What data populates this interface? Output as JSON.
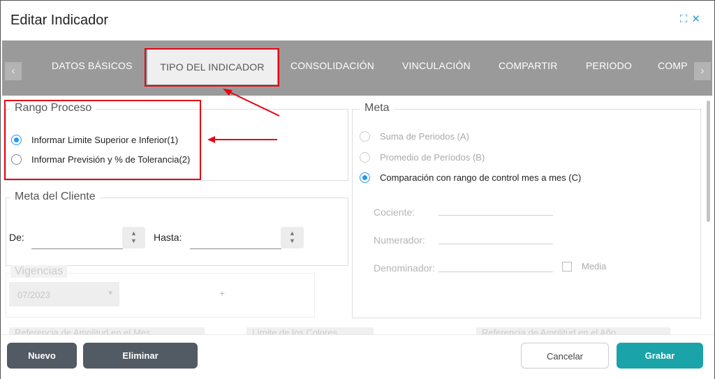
{
  "dialog": {
    "title": "Editar Indicador"
  },
  "tabs": [
    {
      "label": "DATOS BÁSICOS"
    },
    {
      "label": "TIPO DEL INDICADOR",
      "active": true
    },
    {
      "label": "CONSOLIDACIÓN"
    },
    {
      "label": "VINCULACIÓN"
    },
    {
      "label": "COMPARTIR"
    },
    {
      "label": "PERIODO"
    },
    {
      "label": "COMP"
    }
  ],
  "rango_proceso": {
    "legend": "Rango Proceso",
    "options": [
      {
        "label": "Informar Limite Superior e Inferior(1)",
        "selected": true
      },
      {
        "label": "Informar Previsión y % de Tolerancia(2)",
        "selected": false
      }
    ]
  },
  "meta_cliente": {
    "legend": "Meta del Cliente",
    "de_label": "De:",
    "de_value": "",
    "hasta_label": "Hasta:",
    "hasta_value": ""
  },
  "vigencias": {
    "legend": "Vigencias",
    "selected": "07/2023",
    "add": "+"
  },
  "meta": {
    "legend": "Meta",
    "options": [
      {
        "label": "Suma de Periodos (A)",
        "selected": false,
        "disabled": true
      },
      {
        "label": "Promedio de Períodos (B)",
        "selected": false,
        "disabled": true
      },
      {
        "label": "Comparación con rango de control mes a mes (C)",
        "selected": true,
        "disabled": false
      }
    ],
    "cociente_label": "Cociente:",
    "numerador_label": "Numerador:",
    "denominador_label": "Denominador:",
    "media_label": "Media"
  },
  "ghost_sections": {
    "left": "Referencia de Amplitud en el Mes",
    "middle": "Límite de los Colores",
    "right": "Referencia de Amplitud en el Año"
  },
  "footer": {
    "nuevo": "Nuevo",
    "eliminar": "Eliminar",
    "cancelar": "Cancelar",
    "grabar": "Grabar"
  },
  "colors": {
    "accent": "#2196f3",
    "primary_button": "#1aa3a8",
    "dark_button": "#525a63",
    "tabbar": "#9a9a9a",
    "annotation": "#e30613"
  }
}
